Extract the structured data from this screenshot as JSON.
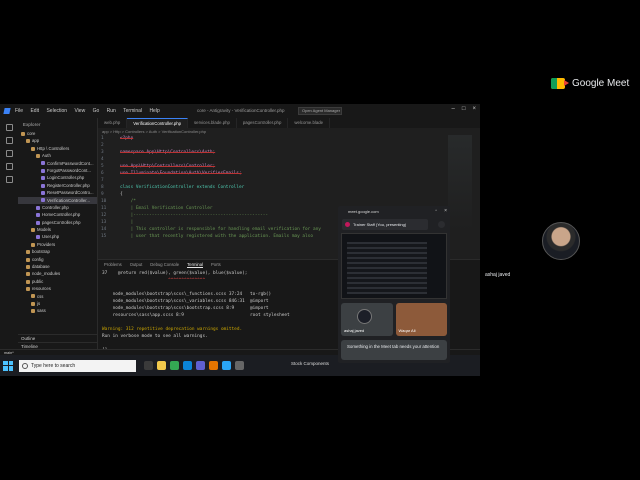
{
  "meet": {
    "brand": "Google Meet",
    "participant_name": "ashaj javed"
  },
  "ide": {
    "app_name": "core - Antigravity - VerificationController.php",
    "menu": [
      "File",
      "Edit",
      "Selection",
      "View",
      "Go",
      "Run",
      "Terminal",
      "Help"
    ],
    "search_placeholder": "Open Agent Manager",
    "explorer_title": "Explorer",
    "tree": [
      {
        "label": "core",
        "depth": 0,
        "type": "folder"
      },
      {
        "label": "app",
        "depth": 1,
        "type": "folder"
      },
      {
        "label": "Http \\ Controllers",
        "depth": 2,
        "type": "folder"
      },
      {
        "label": "Auth",
        "depth": 3,
        "type": "folder"
      },
      {
        "label": "ConfirmPasswordCont...",
        "depth": 4,
        "type": "file"
      },
      {
        "label": "ForgotPasswordCont...",
        "depth": 4,
        "type": "file"
      },
      {
        "label": "LoginController.php",
        "depth": 4,
        "type": "file"
      },
      {
        "label": "RegisterController.php",
        "depth": 4,
        "type": "file"
      },
      {
        "label": "ResetPasswordContro...",
        "depth": 4,
        "type": "file"
      },
      {
        "label": "VerificationController...",
        "depth": 4,
        "type": "file",
        "selected": true
      },
      {
        "label": "Controller.php",
        "depth": 3,
        "type": "file"
      },
      {
        "label": "HomeController.php",
        "depth": 3,
        "type": "file"
      },
      {
        "label": "pagesController.php",
        "depth": 3,
        "type": "file"
      },
      {
        "label": "Models",
        "depth": 2,
        "type": "folder"
      },
      {
        "label": "User.php",
        "depth": 3,
        "type": "file"
      },
      {
        "label": "Providers",
        "depth": 2,
        "type": "folder"
      },
      {
        "label": "bootstrap",
        "depth": 1,
        "type": "folder"
      },
      {
        "label": "config",
        "depth": 1,
        "type": "folder"
      },
      {
        "label": "database",
        "depth": 1,
        "type": "folder"
      },
      {
        "label": "node_modules",
        "depth": 1,
        "type": "folder"
      },
      {
        "label": "public",
        "depth": 1,
        "type": "folder"
      },
      {
        "label": "resources",
        "depth": 1,
        "type": "folder"
      },
      {
        "label": "css",
        "depth": 2,
        "type": "folder"
      },
      {
        "label": "js",
        "depth": 2,
        "type": "folder"
      },
      {
        "label": "sass",
        "depth": 2,
        "type": "folder"
      }
    ],
    "sidebar_bottom": [
      "Outline",
      "Timeline"
    ],
    "tabs": [
      {
        "label": "web.php",
        "active": false
      },
      {
        "label": "VerificationController.php",
        "active": true
      },
      {
        "label": "services.blade.php",
        "active": false
      },
      {
        "label": "pagesController.php",
        "active": false
      },
      {
        "label": "welcome.blade",
        "active": false
      }
    ],
    "breadcrumb": "app > Http > Controllers > Auth > VerificationController.php",
    "code_lines": [
      {
        "n": "1",
        "text": "<?php"
      },
      {
        "n": "2",
        "text": ""
      },
      {
        "n": "3",
        "text": "namespace App\\Http\\Controllers\\Auth;"
      },
      {
        "n": "4",
        "text": ""
      },
      {
        "n": "5",
        "text": "use App\\Http\\Controllers\\Controller;"
      },
      {
        "n": "6",
        "text": "use Illuminate\\Foundation\\Auth\\VerifiesEmails;"
      },
      {
        "n": "7",
        "text": ""
      },
      {
        "n": "8",
        "text": "class VerificationController extends Controller"
      },
      {
        "n": "9",
        "text": "{"
      },
      {
        "n": "10",
        "text": "    /*"
      },
      {
        "n": "11",
        "text": "    | Email Verification Controller"
      },
      {
        "n": "12",
        "text": "    |---------------------------------------------------"
      },
      {
        "n": "13",
        "text": "    |"
      },
      {
        "n": "14",
        "text": "    | This controller is responsible for handling email verification for any"
      },
      {
        "n": "15",
        "text": "    | user that recently registered with the application. Emails may also"
      }
    ],
    "panel_tabs": [
      "Problems",
      "Output",
      "Debug Console",
      "Terminal",
      "Ports"
    ],
    "active_panel_tab": "Terminal",
    "terminal_lines": [
      {
        "text": "37    @return red($value), green($value), blue($value);",
        "cls": ""
      },
      {
        "text": "                         ^^^^^^^^^^^^^^",
        "cls": "red"
      },
      {
        "text": "",
        "cls": ""
      },
      {
        "text": "    node_modules\\bootstrap\\scss\\_functions.scss 37:24   to-rgb()",
        "cls": ""
      },
      {
        "text": "    node_modules\\bootstrap\\scss\\_variables.scss 846:31  @import",
        "cls": ""
      },
      {
        "text": "    node_modules\\bootstrap\\scss\\bootstrap.scss 8:9      @import",
        "cls": ""
      },
      {
        "text": "    resources\\sass\\app.scss 8:9                         root stylesheet",
        "cls": ""
      },
      {
        "text": "",
        "cls": ""
      },
      {
        "text": "Warning: 312 repetitive deprecation warnings omitted.",
        "cls": "warn"
      },
      {
        "text": "Run in verbose mode to see all warnings.",
        "cls": ""
      },
      {
        "text": "",
        "cls": ""
      },
      {
        "text": "[]",
        "cls": ""
      }
    ],
    "status_text": "main*"
  },
  "taskbar": {
    "search_placeholder": "Type here to search",
    "tray_text": "Stock Components"
  },
  "pip": {
    "url": "meet.google.com",
    "header": "Trainer Staff (You, presenting)",
    "tiles": [
      {
        "name": "ashaj javed"
      },
      {
        "name": "Waqar Ali"
      }
    ],
    "notice": "Something in the Meet tab needs your attention"
  }
}
